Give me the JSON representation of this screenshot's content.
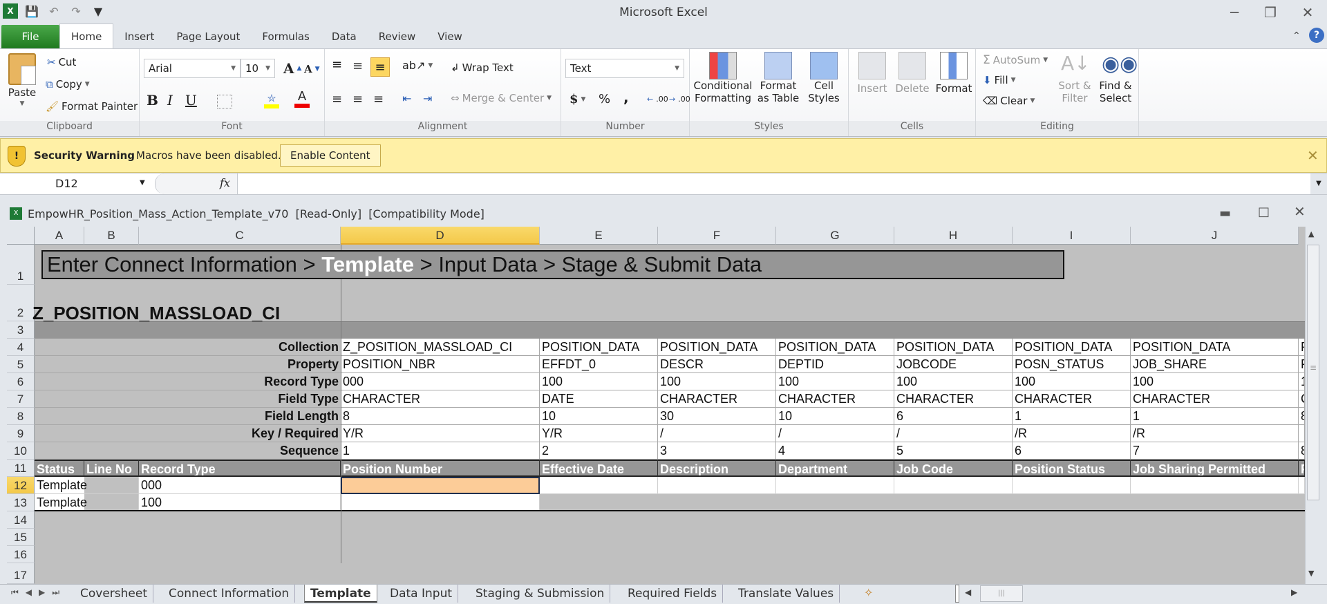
{
  "app": {
    "title": "Microsoft Excel"
  },
  "qat": {
    "save": "save-icon",
    "undo": "undo-icon",
    "redo": "redo-icon",
    "customize": "customize-icon"
  },
  "tabs": [
    "File",
    "Home",
    "Insert",
    "Page Layout",
    "Formulas",
    "Data",
    "Review",
    "View"
  ],
  "active_tab": "Home",
  "ribbon": {
    "clipboard": {
      "label": "Clipboard",
      "paste": "Paste",
      "cut": "Cut",
      "copy": "Copy",
      "format_painter": "Format Painter"
    },
    "font": {
      "label": "Font",
      "font_name": "Arial",
      "font_size": "10",
      "bold": "B",
      "italic": "I",
      "underline": "U"
    },
    "alignment": {
      "label": "Alignment",
      "wrap_text": "Wrap Text",
      "merge_center": "Merge & Center"
    },
    "number": {
      "label": "Number",
      "format": "Text",
      "currency": "$",
      "percent": "%",
      "comma": ",",
      "inc_decimal": ".00",
      "dec_decimal": ".00"
    },
    "styles": {
      "label": "Styles",
      "conditional_1": "Conditional",
      "conditional_2": "Formatting",
      "format_table_1": "Format",
      "format_table_2": "as Table",
      "cell_styles_1": "Cell",
      "cell_styles_2": "Styles"
    },
    "cells": {
      "label": "Cells",
      "insert": "Insert",
      "delete": "Delete",
      "format": "Format"
    },
    "editing": {
      "label": "Editing",
      "autosum": "AutoSum",
      "fill": "Fill",
      "clear": "Clear",
      "sort_1": "Sort &",
      "sort_2": "Filter",
      "find_1": "Find &",
      "find_2": "Select"
    }
  },
  "security": {
    "title": "Security Warning",
    "message": "Macros have been disabled.",
    "button": "Enable Content"
  },
  "formula_bar": {
    "name_box": "D12",
    "fx": "fx",
    "value": ""
  },
  "workbook": {
    "title": "EmpowHR_Position_Mass_Action_Template_v70  [Read-Only]  [Compatibility Mode]"
  },
  "columns": [
    "A",
    "B",
    "C",
    "D",
    "E",
    "F",
    "G",
    "H",
    "I",
    "J"
  ],
  "selected_column": "D",
  "rows": [
    "1",
    "2",
    "3",
    "4",
    "5",
    "6",
    "7",
    "8",
    "9",
    "10",
    "11",
    "12",
    "13",
    "14",
    "15",
    "16",
    "17"
  ],
  "selected_row": "12",
  "sheet": {
    "banner": {
      "pre": "Enter Connect Information > ",
      "current": "Template",
      "post": " > Input Data > Stage & Submit Data"
    },
    "ci_name": "Z_POSITION_MASSLOAD_CI",
    "meta_labels": [
      "Collection",
      "Property",
      "Record Type",
      "Field Type",
      "Field Length",
      "Key / Required",
      "Sequence"
    ],
    "meta_columns": [
      [
        "Z_POSITION_MASSLOAD_CI",
        "POSITION_NBR",
        "000",
        "CHARACTER",
        "8",
        "Y/R",
        "1"
      ],
      [
        "POSITION_DATA",
        "EFFDT_0",
        "100",
        "DATE",
        "10",
        "Y/R",
        "2"
      ],
      [
        "POSITION_DATA",
        "DESCR",
        "100",
        "CHARACTER",
        "30",
        "/",
        "3"
      ],
      [
        "POSITION_DATA",
        "DEPTID",
        "100",
        "CHARACTER",
        "10",
        "/",
        "4"
      ],
      [
        "POSITION_DATA",
        "JOBCODE",
        "100",
        "CHARACTER",
        "6",
        "/",
        "5"
      ],
      [
        "POSITION_DATA",
        "POSN_STATUS",
        "100",
        "CHARACTER",
        "1",
        "/R",
        "6"
      ],
      [
        "POSITION_DATA",
        "JOB_SHARE",
        "100",
        "CHARACTER",
        "1",
        "/R",
        "7"
      ],
      [
        "P",
        "F",
        "1",
        "C",
        "8",
        "",
        "8"
      ]
    ],
    "headers": [
      "Status",
      "Line No",
      "Record Type",
      "Position Number",
      "Effective Date",
      "Description",
      "Department",
      "Job Code",
      "Position Status",
      "Job Sharing Permitted",
      "F"
    ],
    "data_rows": [
      {
        "status": "Template",
        "line_no": "",
        "record_type": "000"
      },
      {
        "status": "Template",
        "line_no": "",
        "record_type": "100"
      }
    ]
  },
  "sheet_tabs": [
    "Coversheet",
    "Connect Information",
    "Template",
    "Data Input",
    "Staging & Submission",
    "Required Fields",
    "Translate Values"
  ],
  "active_sheet": "Template"
}
